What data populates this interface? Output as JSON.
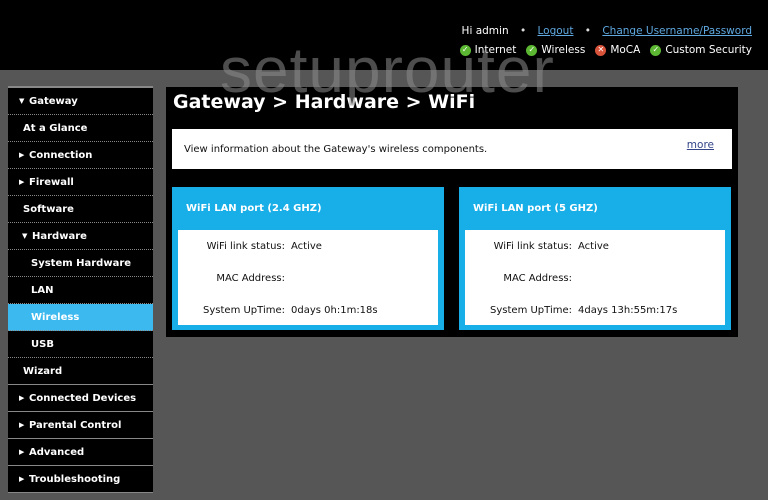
{
  "header": {
    "greeting": "Hi admin",
    "separator": "•",
    "logout_label": "Logout",
    "change_credentials_label": "Change Username/Password",
    "status_items": [
      {
        "label": "Internet",
        "state": "ok",
        "icon": "check-circle-icon"
      },
      {
        "label": "Wireless",
        "state": "ok",
        "icon": "check-circle-icon"
      },
      {
        "label": "MoCA",
        "state": "error",
        "icon": "x-circle-icon"
      },
      {
        "label": "Custom Security",
        "state": "ok",
        "icon": "check-circle-icon"
      }
    ],
    "ok_glyph": "✓",
    "error_glyph": "✕"
  },
  "watermark": "setuprouter",
  "sidebar": {
    "items": [
      {
        "label": "Gateway",
        "arrow": "▼"
      },
      {
        "label": "At a Glance",
        "arrow": ""
      },
      {
        "label": "Connection",
        "arrow": "▶"
      },
      {
        "label": "Firewall",
        "arrow": "▶"
      },
      {
        "label": "Software",
        "arrow": ""
      },
      {
        "label": "Hardware",
        "arrow": "▼"
      },
      {
        "label": "System Hardware",
        "arrow": ""
      },
      {
        "label": "LAN",
        "arrow": ""
      },
      {
        "label": "Wireless",
        "arrow": "",
        "active": true
      },
      {
        "label": "USB",
        "arrow": ""
      },
      {
        "label": "Wizard",
        "arrow": ""
      },
      {
        "label": "Connected Devices",
        "arrow": "▶"
      },
      {
        "label": "Parental Control",
        "arrow": "▶"
      },
      {
        "label": "Advanced",
        "arrow": "▶"
      },
      {
        "label": "Troubleshooting",
        "arrow": "▶"
      }
    ]
  },
  "main": {
    "breadcrumb_title": "Gateway > Hardware > WiFi",
    "description": "View information about the Gateway's wireless components.",
    "more_label": "more",
    "cards": [
      {
        "title": "WiFi LAN port (2.4 GHZ)",
        "rows": [
          {
            "label": "WiFi link status:",
            "value": "Active"
          },
          {
            "label": "MAC Address:",
            "value": ""
          },
          {
            "label": "System UpTime:",
            "value": "0days 0h:1m:18s"
          }
        ]
      },
      {
        "title": "WiFi LAN port (5 GHZ)",
        "rows": [
          {
            "label": "WiFi link status:",
            "value": "Active"
          },
          {
            "label": "MAC Address:",
            "value": ""
          },
          {
            "label": "System UpTime:",
            "value": "4days 13h:55m:17s"
          }
        ]
      }
    ]
  },
  "colors": {
    "accent": "#18aee8",
    "active_nav": "#3cb9ef",
    "ok": "#5cb833",
    "error": "#d9533b",
    "background": "#565656"
  }
}
